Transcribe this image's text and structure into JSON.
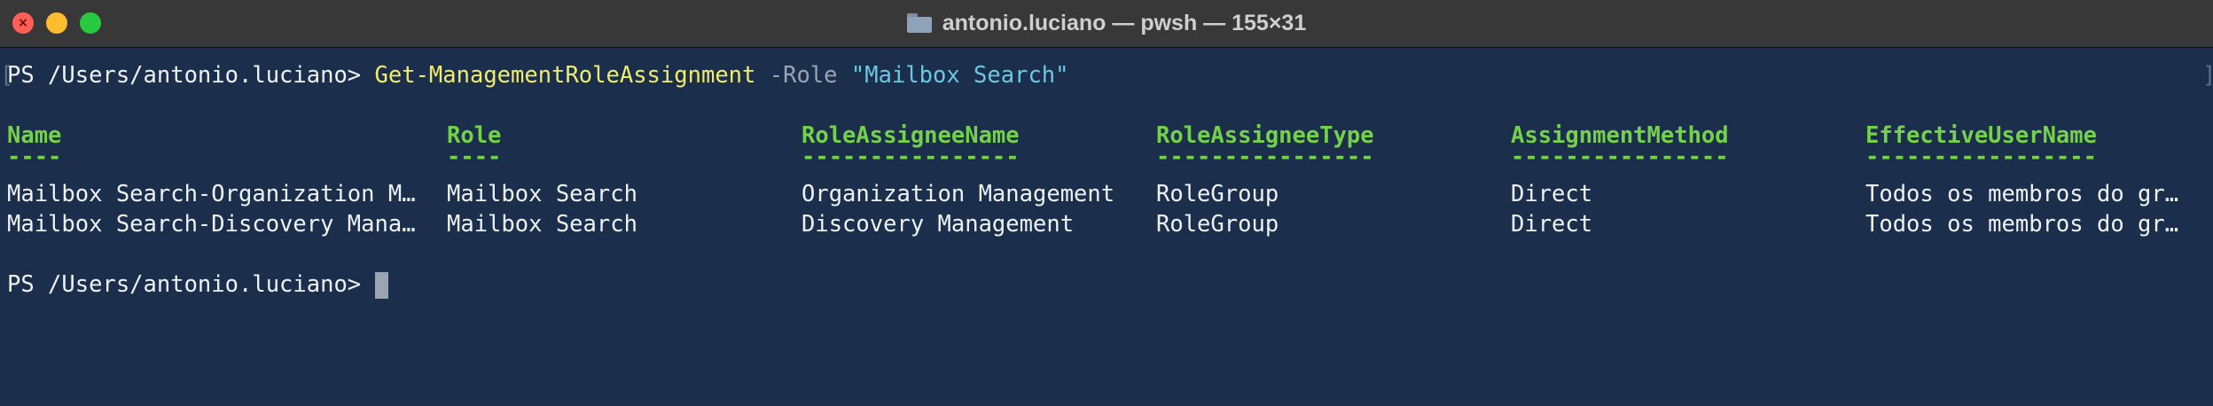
{
  "window": {
    "title": "antonio.luciano — pwsh — 155×31"
  },
  "terminal": {
    "command_line": {
      "prompt": "PS /Users/antonio.luciano> ",
      "cmdlet": "Get-ManagementRoleAssignment",
      "parameter": " -Role ",
      "value": "\"Mailbox Search\""
    },
    "headers": [
      "Name",
      "Role",
      "RoleAssigneeName",
      "RoleAssigneeType",
      "AssignmentMethod",
      "EffectiveUserName"
    ],
    "separators": [
      "----",
      "----",
      "----------------",
      "----------------",
      "----------------",
      "-----------------"
    ],
    "rows": [
      [
        "Mailbox Search-Organization M…",
        "Mailbox Search",
        "Organization Management",
        "RoleGroup",
        "Direct",
        "Todos os membros do gr…"
      ],
      [
        "Mailbox Search-Discovery Mana…",
        "Mailbox Search",
        "Discovery Management",
        "RoleGroup",
        "Direct",
        "Todos os membros do gr…"
      ]
    ],
    "final_prompt": "PS /Users/antonio.luciano> "
  },
  "colors": {
    "background": "#1b2f4d",
    "cmdlet": "#f0ec6c",
    "parameter": "#9aa4b0",
    "string": "#6cc8e2",
    "header": "#74d14a",
    "text": "#eef2f6"
  }
}
